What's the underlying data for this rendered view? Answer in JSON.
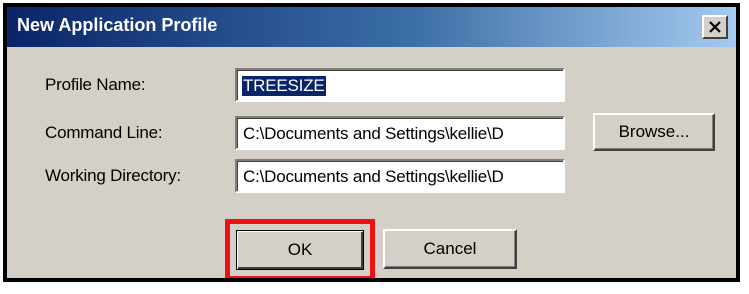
{
  "dialog": {
    "title": "New Application Profile",
    "close_icon": "close-icon"
  },
  "form": {
    "profile_name": {
      "label": "Profile Name:",
      "value": "TREESIZE"
    },
    "command_line": {
      "label": "Command Line:",
      "value": "C:\\Documents and Settings\\kellie\\D"
    },
    "working_directory": {
      "label": "Working Directory:",
      "value": "C:\\Documents and Settings\\kellie\\D"
    }
  },
  "buttons": {
    "browse": "Browse...",
    "ok": "OK",
    "cancel": "Cancel"
  },
  "colors": {
    "title_bar_start": "#0a246a",
    "title_bar_end": "#a6caf0",
    "dialog_face": "#d4d0c8",
    "highlight": "#ee1111",
    "selection": "#0a246a"
  }
}
